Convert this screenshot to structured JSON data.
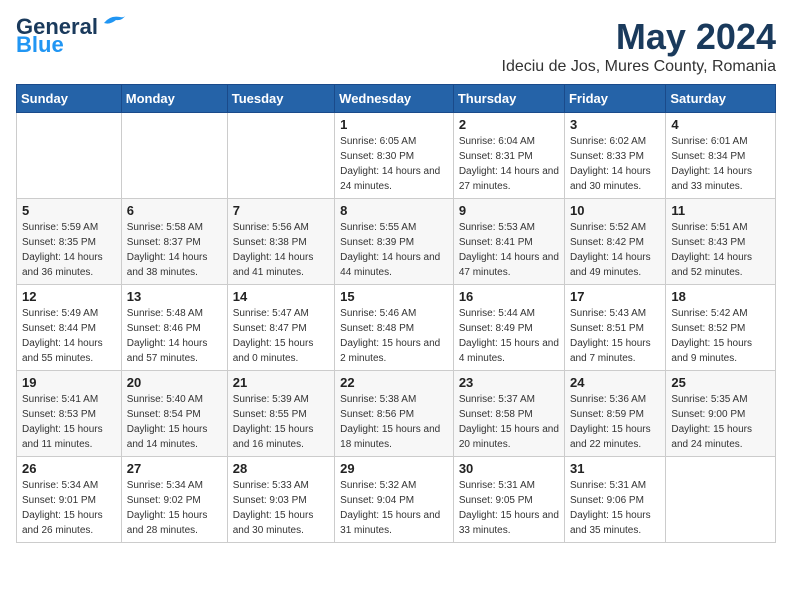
{
  "header": {
    "logo_line1": "General",
    "logo_line2": "Blue",
    "main_title": "May 2024",
    "subtitle": "Ideciu de Jos, Mures County, Romania"
  },
  "weekdays": [
    "Sunday",
    "Monday",
    "Tuesday",
    "Wednesday",
    "Thursday",
    "Friday",
    "Saturday"
  ],
  "weeks": [
    [
      {
        "day": "",
        "sunrise": "",
        "sunset": "",
        "daylight": ""
      },
      {
        "day": "",
        "sunrise": "",
        "sunset": "",
        "daylight": ""
      },
      {
        "day": "",
        "sunrise": "",
        "sunset": "",
        "daylight": ""
      },
      {
        "day": "1",
        "sunrise": "Sunrise: 6:05 AM",
        "sunset": "Sunset: 8:30 PM",
        "daylight": "Daylight: 14 hours and 24 minutes."
      },
      {
        "day": "2",
        "sunrise": "Sunrise: 6:04 AM",
        "sunset": "Sunset: 8:31 PM",
        "daylight": "Daylight: 14 hours and 27 minutes."
      },
      {
        "day": "3",
        "sunrise": "Sunrise: 6:02 AM",
        "sunset": "Sunset: 8:33 PM",
        "daylight": "Daylight: 14 hours and 30 minutes."
      },
      {
        "day": "4",
        "sunrise": "Sunrise: 6:01 AM",
        "sunset": "Sunset: 8:34 PM",
        "daylight": "Daylight: 14 hours and 33 minutes."
      }
    ],
    [
      {
        "day": "5",
        "sunrise": "Sunrise: 5:59 AM",
        "sunset": "Sunset: 8:35 PM",
        "daylight": "Daylight: 14 hours and 36 minutes."
      },
      {
        "day": "6",
        "sunrise": "Sunrise: 5:58 AM",
        "sunset": "Sunset: 8:37 PM",
        "daylight": "Daylight: 14 hours and 38 minutes."
      },
      {
        "day": "7",
        "sunrise": "Sunrise: 5:56 AM",
        "sunset": "Sunset: 8:38 PM",
        "daylight": "Daylight: 14 hours and 41 minutes."
      },
      {
        "day": "8",
        "sunrise": "Sunrise: 5:55 AM",
        "sunset": "Sunset: 8:39 PM",
        "daylight": "Daylight: 14 hours and 44 minutes."
      },
      {
        "day": "9",
        "sunrise": "Sunrise: 5:53 AM",
        "sunset": "Sunset: 8:41 PM",
        "daylight": "Daylight: 14 hours and 47 minutes."
      },
      {
        "day": "10",
        "sunrise": "Sunrise: 5:52 AM",
        "sunset": "Sunset: 8:42 PM",
        "daylight": "Daylight: 14 hours and 49 minutes."
      },
      {
        "day": "11",
        "sunrise": "Sunrise: 5:51 AM",
        "sunset": "Sunset: 8:43 PM",
        "daylight": "Daylight: 14 hours and 52 minutes."
      }
    ],
    [
      {
        "day": "12",
        "sunrise": "Sunrise: 5:49 AM",
        "sunset": "Sunset: 8:44 PM",
        "daylight": "Daylight: 14 hours and 55 minutes."
      },
      {
        "day": "13",
        "sunrise": "Sunrise: 5:48 AM",
        "sunset": "Sunset: 8:46 PM",
        "daylight": "Daylight: 14 hours and 57 minutes."
      },
      {
        "day": "14",
        "sunrise": "Sunrise: 5:47 AM",
        "sunset": "Sunset: 8:47 PM",
        "daylight": "Daylight: 15 hours and 0 minutes."
      },
      {
        "day": "15",
        "sunrise": "Sunrise: 5:46 AM",
        "sunset": "Sunset: 8:48 PM",
        "daylight": "Daylight: 15 hours and 2 minutes."
      },
      {
        "day": "16",
        "sunrise": "Sunrise: 5:44 AM",
        "sunset": "Sunset: 8:49 PM",
        "daylight": "Daylight: 15 hours and 4 minutes."
      },
      {
        "day": "17",
        "sunrise": "Sunrise: 5:43 AM",
        "sunset": "Sunset: 8:51 PM",
        "daylight": "Daylight: 15 hours and 7 minutes."
      },
      {
        "day": "18",
        "sunrise": "Sunrise: 5:42 AM",
        "sunset": "Sunset: 8:52 PM",
        "daylight": "Daylight: 15 hours and 9 minutes."
      }
    ],
    [
      {
        "day": "19",
        "sunrise": "Sunrise: 5:41 AM",
        "sunset": "Sunset: 8:53 PM",
        "daylight": "Daylight: 15 hours and 11 minutes."
      },
      {
        "day": "20",
        "sunrise": "Sunrise: 5:40 AM",
        "sunset": "Sunset: 8:54 PM",
        "daylight": "Daylight: 15 hours and 14 minutes."
      },
      {
        "day": "21",
        "sunrise": "Sunrise: 5:39 AM",
        "sunset": "Sunset: 8:55 PM",
        "daylight": "Daylight: 15 hours and 16 minutes."
      },
      {
        "day": "22",
        "sunrise": "Sunrise: 5:38 AM",
        "sunset": "Sunset: 8:56 PM",
        "daylight": "Daylight: 15 hours and 18 minutes."
      },
      {
        "day": "23",
        "sunrise": "Sunrise: 5:37 AM",
        "sunset": "Sunset: 8:58 PM",
        "daylight": "Daylight: 15 hours and 20 minutes."
      },
      {
        "day": "24",
        "sunrise": "Sunrise: 5:36 AM",
        "sunset": "Sunset: 8:59 PM",
        "daylight": "Daylight: 15 hours and 22 minutes."
      },
      {
        "day": "25",
        "sunrise": "Sunrise: 5:35 AM",
        "sunset": "Sunset: 9:00 PM",
        "daylight": "Daylight: 15 hours and 24 minutes."
      }
    ],
    [
      {
        "day": "26",
        "sunrise": "Sunrise: 5:34 AM",
        "sunset": "Sunset: 9:01 PM",
        "daylight": "Daylight: 15 hours and 26 minutes."
      },
      {
        "day": "27",
        "sunrise": "Sunrise: 5:34 AM",
        "sunset": "Sunset: 9:02 PM",
        "daylight": "Daylight: 15 hours and 28 minutes."
      },
      {
        "day": "28",
        "sunrise": "Sunrise: 5:33 AM",
        "sunset": "Sunset: 9:03 PM",
        "daylight": "Daylight: 15 hours and 30 minutes."
      },
      {
        "day": "29",
        "sunrise": "Sunrise: 5:32 AM",
        "sunset": "Sunset: 9:04 PM",
        "daylight": "Daylight: 15 hours and 31 minutes."
      },
      {
        "day": "30",
        "sunrise": "Sunrise: 5:31 AM",
        "sunset": "Sunset: 9:05 PM",
        "daylight": "Daylight: 15 hours and 33 minutes."
      },
      {
        "day": "31",
        "sunrise": "Sunrise: 5:31 AM",
        "sunset": "Sunset: 9:06 PM",
        "daylight": "Daylight: 15 hours and 35 minutes."
      },
      {
        "day": "",
        "sunrise": "",
        "sunset": "",
        "daylight": ""
      }
    ]
  ]
}
